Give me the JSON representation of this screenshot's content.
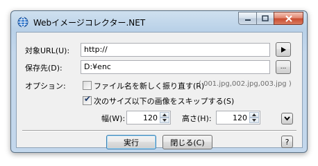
{
  "window": {
    "title": "Webイメージコレクター.NET"
  },
  "form": {
    "url_label": "対象URL(U):",
    "url_value": "http://",
    "save_label": "保存先(D):",
    "save_value": "D:¥enc",
    "browse_label": "...",
    "options_label": "オプション:",
    "option_rename": {
      "label": "ファイル名を新しく振り直す(R)",
      "hint": "( 001.jpg,002.jpg,003.jpg )",
      "checked": false
    },
    "option_skip": {
      "label": "次のサイズ以下の画像をスキップする(S)",
      "checked": true
    },
    "width_label": "幅(W):",
    "width_value": "120",
    "height_label": "高さ(H):",
    "height_value": "120"
  },
  "buttons": {
    "run": "実行",
    "close": "閉じる(C)",
    "help": "?"
  },
  "icons": {
    "app": "globe-icon",
    "go": "play-icon",
    "expand": "chevron-down-icon"
  }
}
